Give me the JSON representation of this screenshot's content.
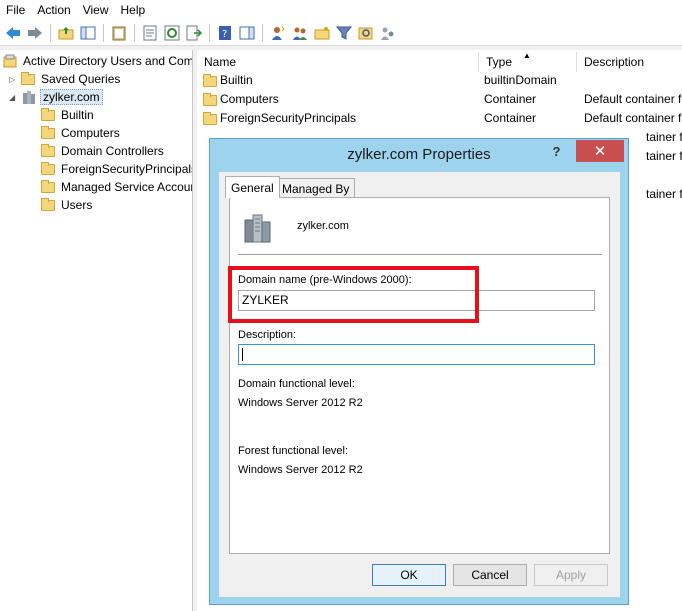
{
  "menu": [
    "File",
    "Action",
    "View",
    "Help"
  ],
  "tree": {
    "root": "Active Directory Users and Com",
    "saved_queries": "Saved Queries",
    "domain": "zylker.com",
    "children": [
      "Builtin",
      "Computers",
      "Domain Controllers",
      "ForeignSecurityPrincipals",
      "Managed Service Accour",
      "Users"
    ]
  },
  "list": {
    "headers": [
      "Name",
      "Type",
      "Description"
    ],
    "sort_indicator": "▲",
    "rows": [
      {
        "name": "Builtin",
        "type": "builtinDomain",
        "description": ""
      },
      {
        "name": "Computers",
        "type": "Container",
        "description": "Default container fo"
      },
      {
        "name": "ForeignSecurityPrincipals",
        "type": "Container",
        "description": "Default container fo"
      }
    ],
    "truncated": [
      "tainer f",
      "tainer f",
      "tainer f"
    ]
  },
  "dialog": {
    "title": "zylker.com Properties",
    "help_label": "?",
    "close_label": "✕",
    "tabs": [
      "General",
      "Managed By"
    ],
    "object_name": "zylker.com",
    "domain_name_label": "Domain name (pre-Windows 2000):",
    "domain_name_value": "ZYLKER",
    "description_label": "Description:",
    "description_value": "",
    "domain_level_label": "Domain functional level:",
    "domain_level_value": "Windows Server 2012 R2",
    "forest_level_label": "Forest functional level:",
    "forest_level_value": "Windows Server 2012 R2",
    "ok_label": "OK",
    "cancel_label": "Cancel",
    "apply_label": "Apply"
  },
  "colors": {
    "dialog_frame": "#9ed3ee",
    "close_button": "#c74f4f",
    "highlight_box": "#e5101c"
  }
}
